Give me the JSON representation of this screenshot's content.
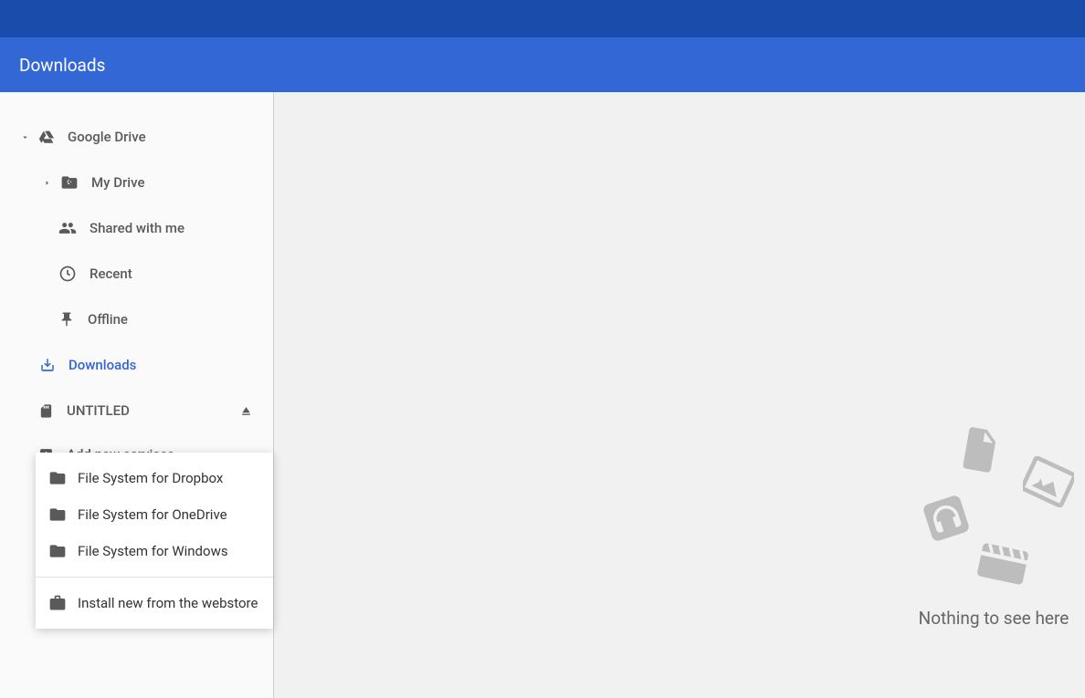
{
  "title_bar": {
    "title": "Downloads"
  },
  "sidebar": {
    "google_drive": "Google Drive",
    "my_drive": "My Drive",
    "shared_with_me": "Shared with me",
    "recent": "Recent",
    "offline": "Offline",
    "downloads": "Downloads",
    "untitled": "UNTITLED",
    "add_new_services": "Add new services"
  },
  "popup": {
    "items": [
      "File System for Dropbox",
      "File System for OneDrive",
      "File System for Windows"
    ],
    "install": "Install new from the webstore"
  },
  "empty_state": {
    "text": "Nothing to see here"
  }
}
